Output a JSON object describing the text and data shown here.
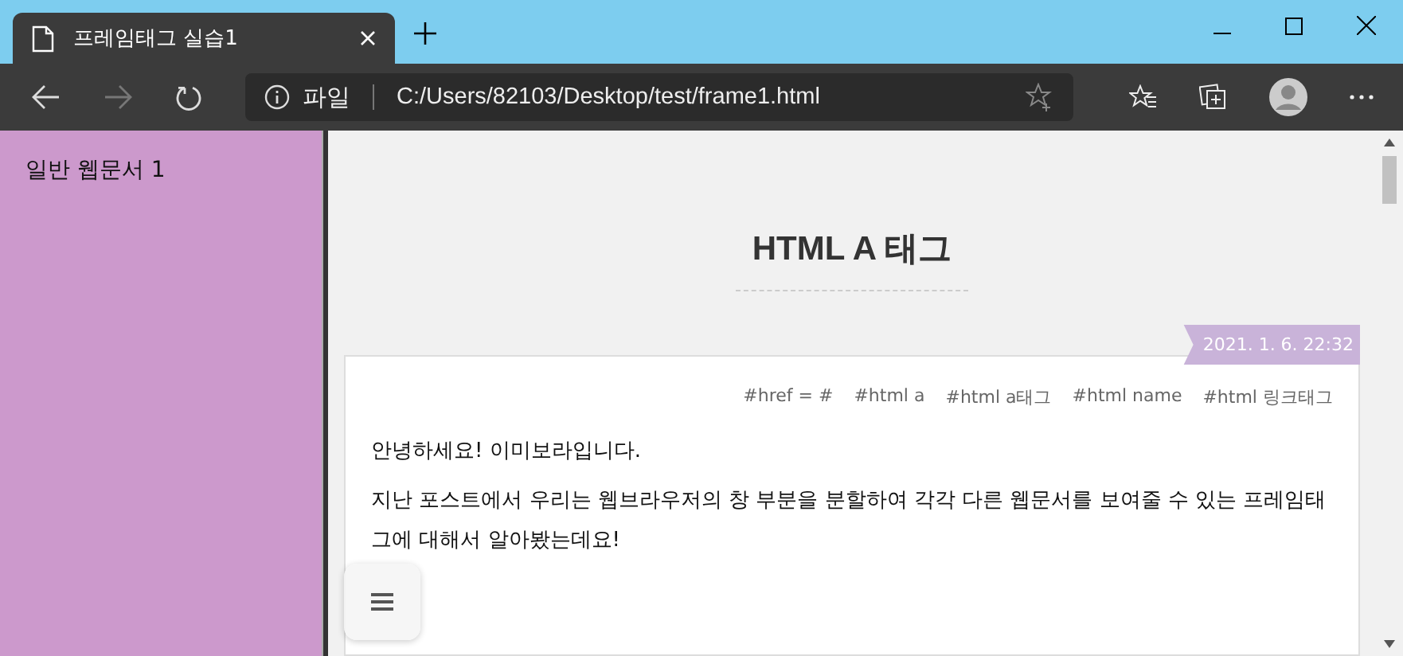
{
  "tab": {
    "title": "프레임태그 실습1",
    "selected": true
  },
  "address": {
    "scheme": "파일",
    "url": "C:/Users/82103/Desktop/test/frame1.html"
  },
  "left_frame": {
    "link": "일반 웹문서 1"
  },
  "post": {
    "title": "HTML A 태그",
    "date": "2021. 1. 6. 22:32",
    "tags": [
      "#href = #",
      "#html a",
      "#html a태그",
      "#html name",
      "#html 링크태그"
    ],
    "paragraphs": [
      "안녕하세요! 이미보라입니다.",
      "지난 포스트에서 우리는 웹브라우저의 창 부분을 분할하여 각각 다른 웹문서를 보여줄 수 있는 프레임태그에 대해서 알아봤는데요!"
    ]
  }
}
